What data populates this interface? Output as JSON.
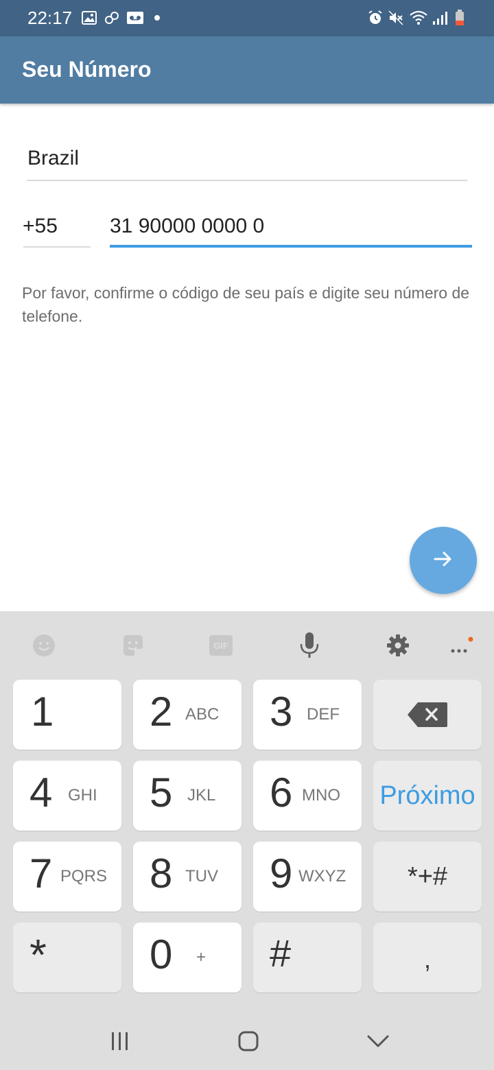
{
  "status_bar": {
    "time": "22:17",
    "left_icons": [
      "image-icon",
      "link-icon",
      "voicemail-icon",
      "notification-dot-icon"
    ],
    "right_icons": [
      "alarm-icon",
      "mute-icon",
      "wifi-icon",
      "signal-icon",
      "battery-low-icon"
    ]
  },
  "app_bar": {
    "title": "Seu Número"
  },
  "form": {
    "country": "Brazil",
    "country_code": "+55",
    "phone_number": "31 90000 0000 0",
    "hint": "Por favor, confirme o código de seu país e digite seu número de telefone."
  },
  "fab": {
    "icon": "arrow-right-icon"
  },
  "keyboard": {
    "toolbar_icons": [
      "emoji-icon",
      "sticker-icon",
      "gif-icon",
      "microphone-icon",
      "settings-icon",
      "more-icon"
    ],
    "gif_label": "GIF",
    "keys": [
      {
        "num": "1",
        "letters": ""
      },
      {
        "num": "2",
        "letters": "ABC"
      },
      {
        "num": "3",
        "letters": "DEF"
      },
      {
        "num": "4",
        "letters": "GHI"
      },
      {
        "num": "5",
        "letters": "JKL"
      },
      {
        "num": "6",
        "letters": "MNO"
      },
      {
        "num": "7",
        "letters": "PQRS"
      },
      {
        "num": "8",
        "letters": "TUV"
      },
      {
        "num": "9",
        "letters": "WXYZ"
      },
      {
        "num": "0",
        "letters": "+"
      }
    ],
    "next_label": "Próximo",
    "symbols_label": "*+#",
    "asterisk_label": "*",
    "hash_label": "#",
    "comma_label": ",",
    "accent_color": "#3D9CE2"
  },
  "nav_bar": {
    "icons": [
      "recents-icon",
      "home-icon",
      "back-icon"
    ]
  },
  "colors": {
    "status_bar": "#416385",
    "app_bar": "#517DA2",
    "fab": "#65A9E0",
    "keyboard_bg": "#dedede"
  }
}
